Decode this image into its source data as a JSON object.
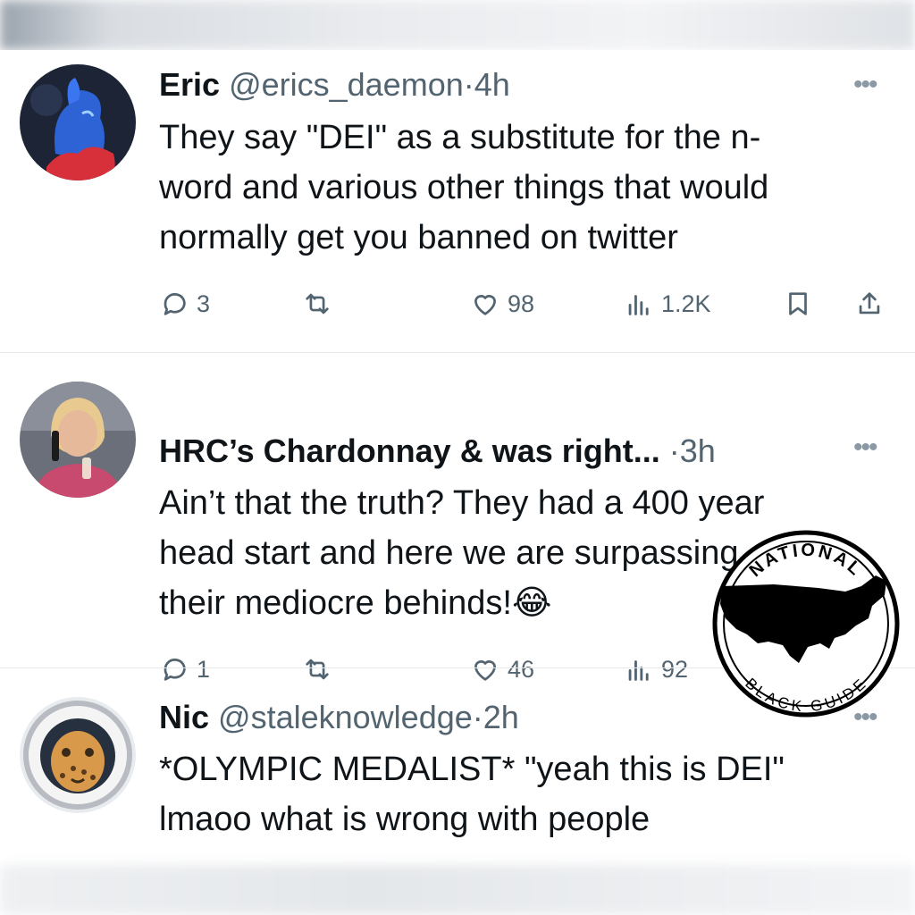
{
  "tweets": [
    {
      "name": "Eric",
      "handle": "@erics_daemon",
      "time": "4h",
      "lines": [
        "They say \"DEI\" as a substitute for the n-",
        "word and various other things that would",
        "normally get you banned on twitter"
      ],
      "replies": "3",
      "reposts": "",
      "likes": "98",
      "views": "1.2K",
      "more": "•••"
    },
    {
      "name": "HRC’s Chardonnay & was right...",
      "handle": "",
      "time": "3h",
      "lines": [
        "Ain’t that the truth? They had a 400 year",
        "head start and here we are surpassing",
        "their mediocre behinds!😂"
      ],
      "replies": "1",
      "reposts": "",
      "likes": "46",
      "views": "92",
      "more": "•••"
    },
    {
      "name": "Nic",
      "handle": "@staleknowledge",
      "time": "2h",
      "lines": [
        "*OLYMPIC MEDALIST* \"yeah this is DEI\"",
        "lmaoo what is wrong with people"
      ],
      "more": "•••"
    }
  ],
  "watermark": {
    "top_text": "NATIONAL",
    "bottom_text": "BLACK GUIDE"
  },
  "icons": {
    "reply": "reply-icon",
    "repost": "repost-icon",
    "like": "heart-icon",
    "views": "views-icon",
    "bookmark": "bookmark-icon",
    "share": "share-icon"
  },
  "colors": {
    "text": "#0f1419",
    "muted": "#536471",
    "divider": "#e6e8ea"
  }
}
